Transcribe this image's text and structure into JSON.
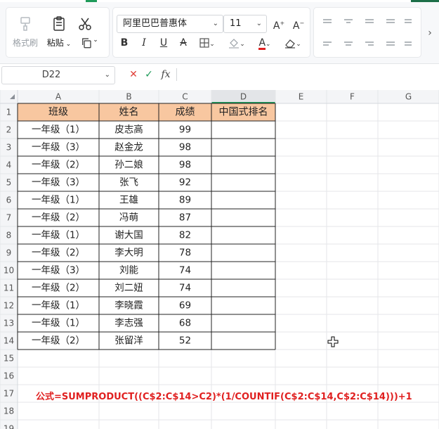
{
  "ribbon": {
    "format_painter_label": "格式刷",
    "paste_label": "粘贴",
    "font_name": "阿里巴巴普惠体",
    "font_size": "11"
  },
  "formula_bar": {
    "name_box": "D22",
    "fx_label": "fx",
    "cancel_glyph": "✕",
    "confirm_glyph": "✓"
  },
  "sheet": {
    "columns": [
      "A",
      "B",
      "C",
      "D",
      "E",
      "F",
      "G"
    ],
    "selected_column": "D",
    "row_numbers": [
      "1",
      "2",
      "3",
      "4",
      "5",
      "6",
      "7",
      "8",
      "9",
      "10",
      "11",
      "12",
      "13",
      "14",
      "15",
      "16",
      "17",
      "18",
      "19"
    ],
    "headers": [
      "班级",
      "姓名",
      "成绩",
      "中国式排名"
    ],
    "rows": [
      [
        "一年级（1）",
        "皮志高",
        "99",
        ""
      ],
      [
        "一年级（3）",
        "赵金龙",
        "98",
        ""
      ],
      [
        "一年级（2）",
        "孙二娘",
        "98",
        ""
      ],
      [
        "一年级（3）",
        "张飞",
        "92",
        ""
      ],
      [
        "一年级（1）",
        "王雄",
        "89",
        ""
      ],
      [
        "一年级（2）",
        "冯萌",
        "87",
        ""
      ],
      [
        "一年级（1）",
        "谢大国",
        "82",
        ""
      ],
      [
        "一年级（2）",
        "李大明",
        "78",
        ""
      ],
      [
        "一年级（3）",
        "刘能",
        "74",
        ""
      ],
      [
        "一年级（2）",
        "刘二妞",
        "74",
        ""
      ],
      [
        "一年级（1）",
        "李晓霞",
        "69",
        ""
      ],
      [
        "一年级（1）",
        "李志强",
        "68",
        ""
      ],
      [
        "一年级（2）",
        "张留洋",
        "52",
        ""
      ]
    ],
    "note": "公式=SUMPRODUCT((C$2:C$14>C2)*(1/COUNTIF(C$2:C$14,C$2:C$14)))+1"
  },
  "colors": {
    "header_fill": "#f8c7a0",
    "note_color": "#e02020",
    "accent_green": "#1f9b5a"
  }
}
